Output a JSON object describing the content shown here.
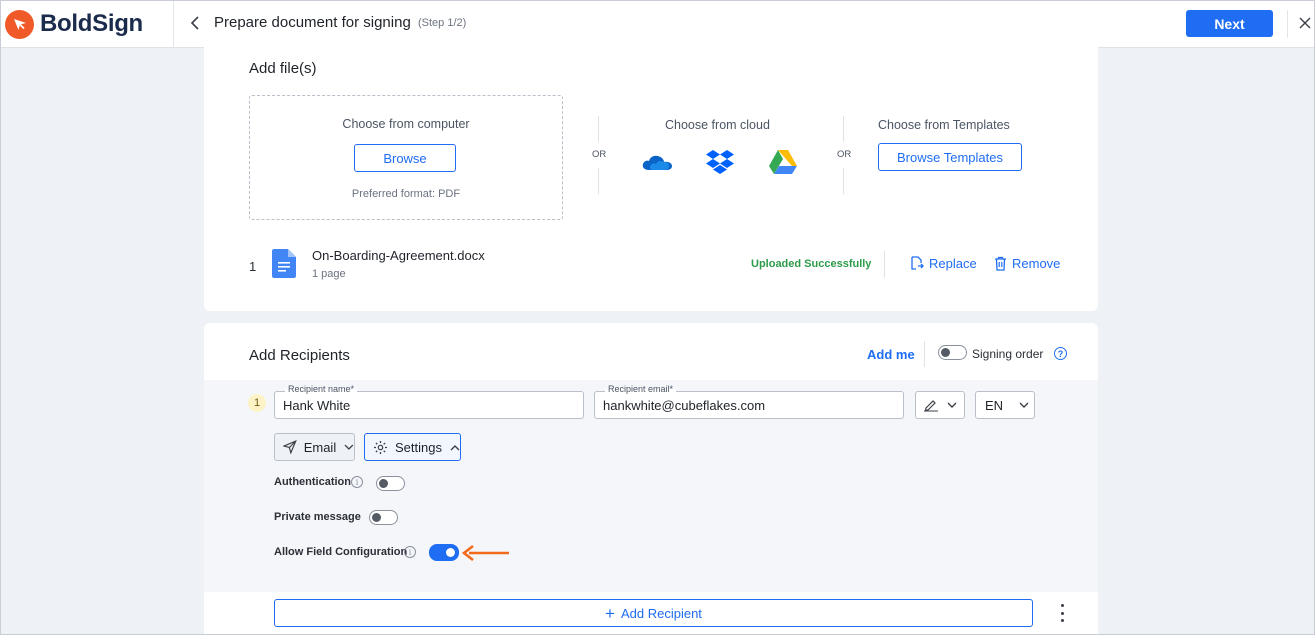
{
  "app": {
    "name": "BoldSign"
  },
  "header": {
    "title": "Prepare document for signing",
    "step": "(Step 1/2)",
    "next_label": "Next"
  },
  "files": {
    "section_title": "Add file(s)",
    "computer": {
      "label": "Choose from computer",
      "browse_label": "Browse",
      "format_note": "Preferred format: PDF"
    },
    "or_label": "OR",
    "cloud": {
      "label": "Choose from cloud",
      "providers": [
        "onedrive-icon",
        "dropbox-icon",
        "google-drive-icon"
      ]
    },
    "templates": {
      "label": "Choose from Templates",
      "browse_label": "Browse Templates"
    },
    "items": [
      {
        "index": "1",
        "name": "On-Boarding-Agreement.docx",
        "pages": "1 page",
        "status": "Uploaded Successfully"
      }
    ],
    "replace_label": "Replace",
    "remove_label": "Remove"
  },
  "recipients": {
    "section_title": "Add Recipients",
    "add_me_label": "Add me",
    "signing_order_label": "Signing order",
    "signing_order_on": false,
    "help_glyph": "?",
    "list": [
      {
        "index": "1",
        "name_label": "Recipient name*",
        "name": "Hank White",
        "email_label": "Recipient email*",
        "email": "hankwhite@cubeflakes.com",
        "language": "EN",
        "delivery_label": "Email",
        "settings_label": "Settings",
        "options": [
          {
            "label": "Authentication",
            "enabled": false
          },
          {
            "label": "Private message",
            "enabled": false
          },
          {
            "label": "Allow Field Configuration",
            "enabled": true
          }
        ]
      }
    ],
    "add_recipient_label": "Add Recipient"
  },
  "colors": {
    "accent": "#1f6df2",
    "brand": "#f05a28",
    "success": "#2e9b4b",
    "highlight_arrow": "#f26a1b"
  }
}
